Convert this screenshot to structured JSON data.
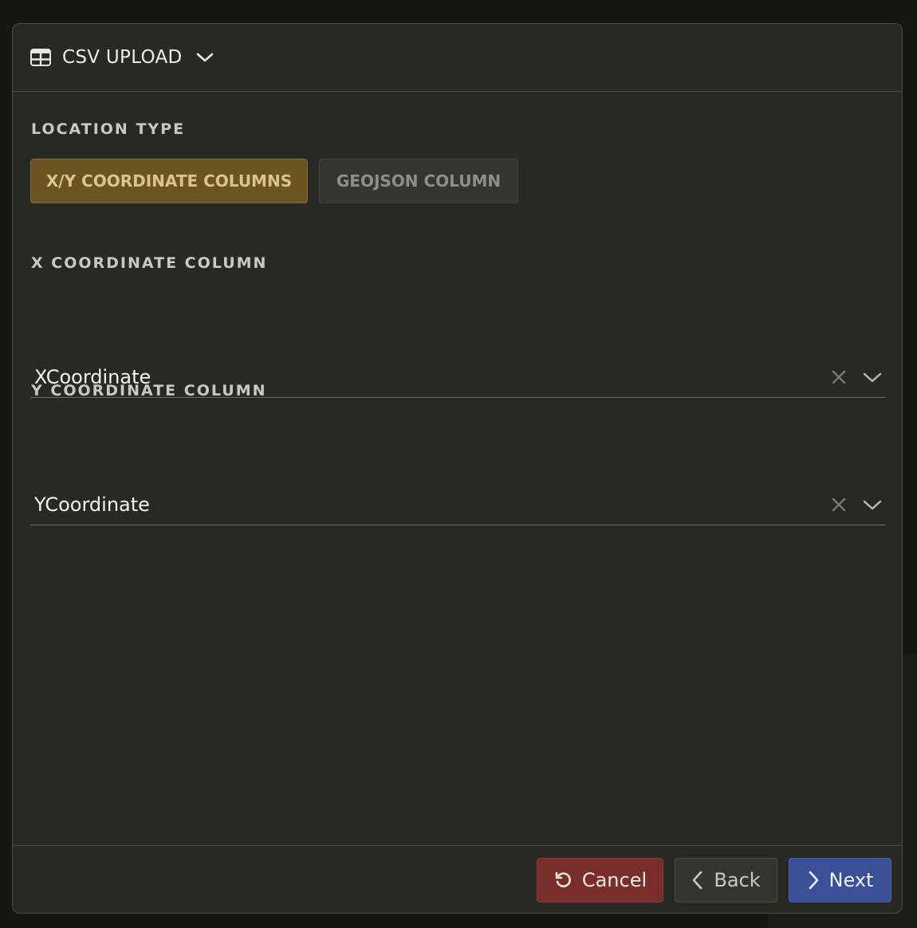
{
  "header": {
    "title": "CSV UPLOAD",
    "icon": "table-icon"
  },
  "location_type": {
    "label": "LOCATION TYPE",
    "options": [
      "X/Y COORDINATE COLUMNS",
      "GEOJSON COLUMN"
    ],
    "selected": "X/Y COORDINATE COLUMNS"
  },
  "x_column": {
    "label": "X COORDINATE COLUMN",
    "value": "XCoordinate"
  },
  "y_column": {
    "label": "Y COORDINATE COLUMN",
    "value": "YCoordinate"
  },
  "footer": {
    "cancel_label": "Cancel",
    "back_label": "Back",
    "next_label": "Next"
  },
  "colors": {
    "accent_active": "#6a5426",
    "cancel": "#7a2e2c",
    "next": "#3a4f96",
    "background": "#282825"
  }
}
